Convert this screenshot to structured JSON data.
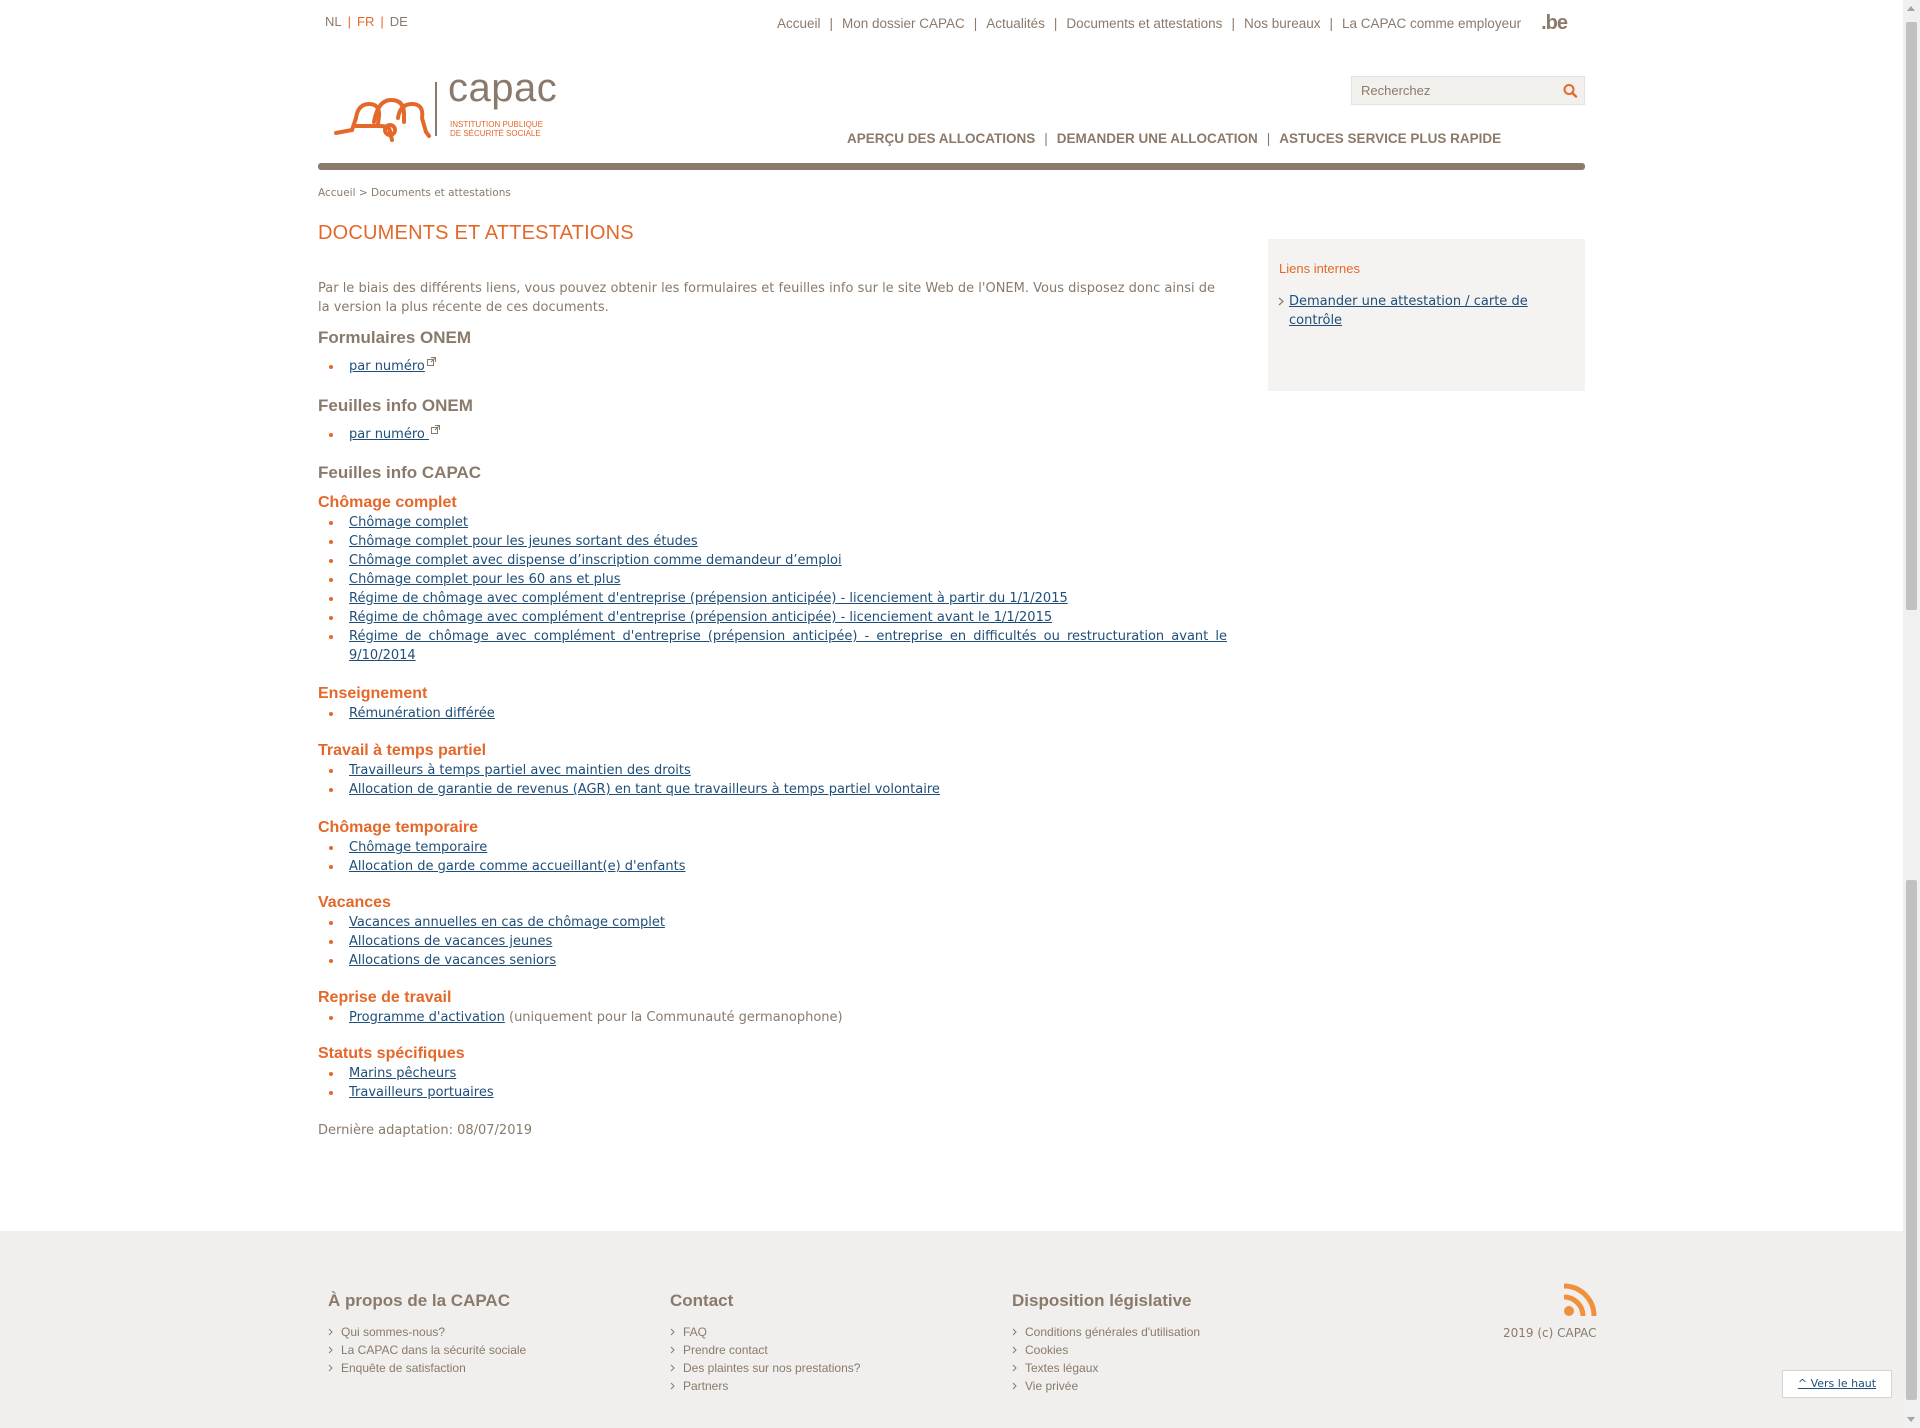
{
  "lang": {
    "items": [
      "NL",
      "FR",
      "DE"
    ]
  },
  "topnav": {
    "items": [
      "Accueil",
      "Mon dossier CAPAC",
      "Actualités",
      "Documents et attestations",
      "Nos bureaux",
      "La CAPAC comme employeur"
    ],
    "be_logo": ".be"
  },
  "logo": {
    "name": "capac",
    "line1": "INSTITUTION PUBLIQUE",
    "line2": "DE SÉCURITÉ SOCIALE"
  },
  "search": {
    "placeholder": "Recherchez",
    "icon": "search-icon"
  },
  "mainnav": {
    "items": [
      "APERÇU DES ALLOCATIONS",
      "DEMANDER UNE ALLOCATION",
      "ASTUCES SERVICE PLUS RAPIDE"
    ]
  },
  "breadcrumb": {
    "home": "Accueil",
    "sep": " > ",
    "current": "Documents et attestations"
  },
  "page": {
    "title": "DOCUMENTS ET ATTESTATIONS",
    "intro": "Par le biais des différents liens, vous pouvez obtenir les formulaires et feuilles info sur le site Web de l'ONEM. Vous disposez donc ainsi de la version la plus récente de ces documents.",
    "formulaires_title": "Formulaires ONEM",
    "formulaires_link": "par numéro",
    "feuilles_onem_title": "Feuilles info ONEM",
    "feuilles_onem_link": "par numéro ",
    "feuilles_capac_title": "Feuilles info CAPAC",
    "groups": [
      {
        "title": "Chômage complet",
        "links": [
          "Chômage complet",
          "Chômage complet pour les jeunes sortant des études",
          "Chômage complet avec dispense d’inscription comme demandeur d’emploi",
          "Chômage complet pour les 60 ans et plus",
          "Régime de chômage avec complément d'entreprise (prépension anticipée) - licenciement à partir du 1/1/2015",
          "Régime de chômage avec complément d'entreprise (prépension anticipée) - licenciement avant le 1/1/2015",
          "Régime de chômage avec complément d'entreprise (prépension anticipée) - entreprise en difficultés ou restructuration avant le 9/10/2014"
        ]
      },
      {
        "title": "Enseignement",
        "links": [
          "Rémunération différée"
        ]
      },
      {
        "title": "Travail à temps partiel",
        "links": [
          "Travailleurs à temps partiel avec maintien des droits",
          "Allocation de garantie de revenus (AGR) en tant que travailleurs à temps partiel volontaire"
        ]
      },
      {
        "title": "Chômage temporaire",
        "links": [
          "Chômage temporaire",
          "Allocation de garde comme accueillant(e) d'enfants"
        ]
      },
      {
        "title": "Vacances",
        "links": [
          "Vacances annuelles en cas de chômage complet",
          "Allocations de vacances jeunes",
          "Allocations de vacances seniors"
        ]
      },
      {
        "title": "Reprise de travail",
        "links": [
          "Programme d'activation"
        ],
        "note": " (uniquement pour la Communauté germanophone)"
      },
      {
        "title": "Statuts spécifiques",
        "links": [
          "Marins pêcheurs",
          "Travailleurs portuaires"
        ]
      }
    ],
    "last_modified": "Dernière adaptation: 08/07/2019"
  },
  "sidebar": {
    "title": "Liens internes",
    "link": "Demander une attestation / carte de contrôle"
  },
  "footer": {
    "col1": {
      "title": "À propos de la CAPAC",
      "items": [
        "Qui sommes-nous?",
        "La CAPAC dans la sécurité sociale",
        "Enquête de satisfaction"
      ]
    },
    "col2": {
      "title": "Contact",
      "items": [
        "FAQ",
        "Prendre contact",
        "Des plaintes sur nos prestations?",
        "Partners"
      ]
    },
    "col3": {
      "title": "Disposition législative",
      "items": [
        "Conditions générales d'utilisation",
        "Cookies",
        "Textes légaux",
        "Vie privée"
      ]
    },
    "copyright": "2019 (c) CAPAC",
    "rss_icon": "rss-icon",
    "to_top": "^ Vers le haut"
  },
  "colors": {
    "accent": "#e4682a",
    "text": "#8a7a6b",
    "link": "#1f4e79",
    "footer_bg": "#f0efed"
  }
}
